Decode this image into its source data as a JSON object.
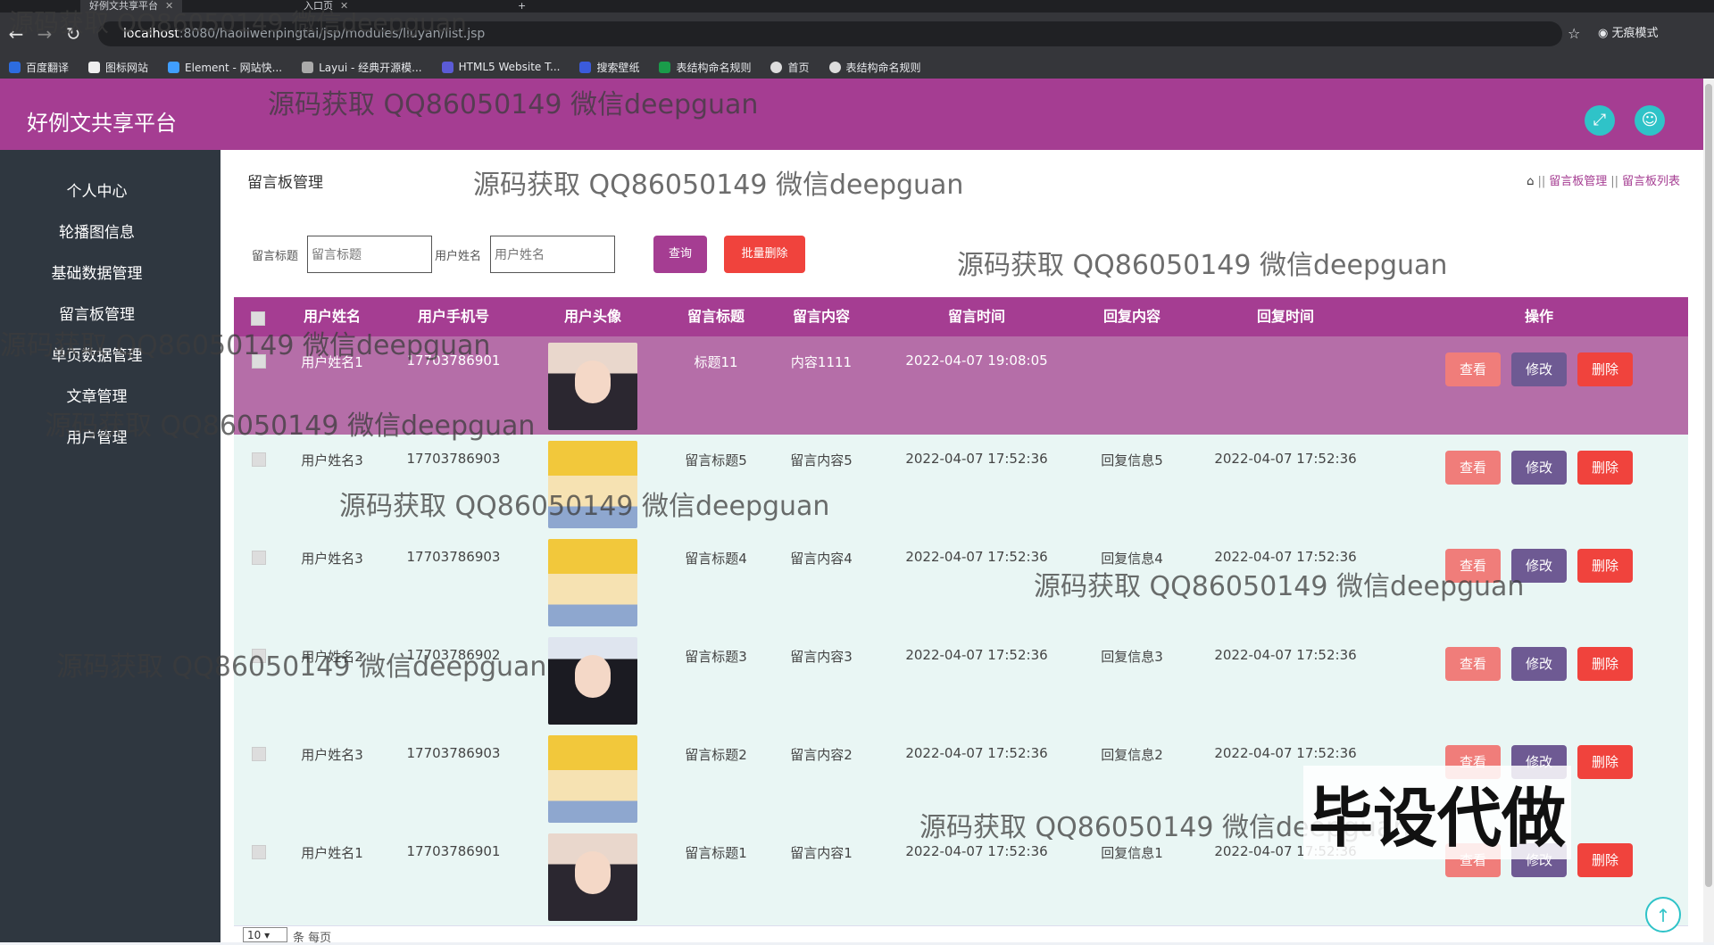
{
  "browser": {
    "tabs": [
      {
        "label": "好例文共享平台",
        "active": true
      },
      {
        "label": "入口页",
        "active": false
      }
    ],
    "url_host": "localhost",
    "url_path": ":8080/haoliwenpingtai/jsp/modules/liuyan/list.jsp",
    "incognito_label": "无痕模式",
    "bookmarks": [
      "百度翻译",
      "图标网站",
      "Element - 网站快...",
      "Layui - 经典开源模...",
      "HTML5 Website T...",
      "搜索壁纸",
      "表结构命名规则",
      "首页",
      "表结构命名规则"
    ]
  },
  "header": {
    "title": "好例文共享平台"
  },
  "sidebar": {
    "items": [
      "个人中心",
      "轮播图信息",
      "基础数据管理",
      "留言板管理",
      "单页数据管理",
      "文章管理",
      "用户管理"
    ]
  },
  "page": {
    "title": "留言板管理",
    "breadcrumb": [
      "留言板管理",
      "留言板列表"
    ]
  },
  "filters": {
    "title_label": "留言标题",
    "title_placeholder": "留言标题",
    "name_label": "用户姓名",
    "name_placeholder": "用户姓名",
    "query_button": "查询",
    "batch_delete_button": "批量删除"
  },
  "table": {
    "headers": [
      "用户姓名",
      "用户手机号",
      "用户头像",
      "留言标题",
      "留言内容",
      "留言时间",
      "回复内容",
      "回复时间",
      "操作"
    ],
    "actions": {
      "view": "查看",
      "edit": "修改",
      "delete": "删除"
    },
    "rows": [
      {
        "name": "用户姓名1",
        "phone": "17703786901",
        "title": "标题11",
        "content": "内容1111",
        "time": "2022-04-07 19:08:05",
        "reply": "",
        "reply_time": ""
      },
      {
        "name": "用户姓名3",
        "phone": "17703786903",
        "title": "留言标题5",
        "content": "留言内容5",
        "time": "2022-04-07 17:52:36",
        "reply": "回复信息5",
        "reply_time": "2022-04-07 17:52:36"
      },
      {
        "name": "用户姓名3",
        "phone": "17703786903",
        "title": "留言标题4",
        "content": "留言内容4",
        "time": "2022-04-07 17:52:36",
        "reply": "回复信息4",
        "reply_time": "2022-04-07 17:52:36"
      },
      {
        "name": "用户姓名2",
        "phone": "17703786902",
        "title": "留言标题3",
        "content": "留言内容3",
        "time": "2022-04-07 17:52:36",
        "reply": "回复信息3",
        "reply_time": "2022-04-07 17:52:36"
      },
      {
        "name": "用户姓名3",
        "phone": "17703786903",
        "title": "留言标题2",
        "content": "留言内容2",
        "time": "2022-04-07 17:52:36",
        "reply": "回复信息2",
        "reply_time": "2022-04-07 17:52:36"
      },
      {
        "name": "用户姓名1",
        "phone": "17703786901",
        "title": "留言标题1",
        "content": "留言内容1",
        "time": "2022-04-07 17:52:36",
        "reply": "回复信息1",
        "reply_time": "2022-04-07 17:52:36"
      }
    ]
  },
  "pagination": {
    "page_size": "10",
    "suffix": "条 每页"
  },
  "overlay": {
    "watermark": "源码获取 QQ86050149 微信deepguan",
    "banner": "毕设代做"
  }
}
